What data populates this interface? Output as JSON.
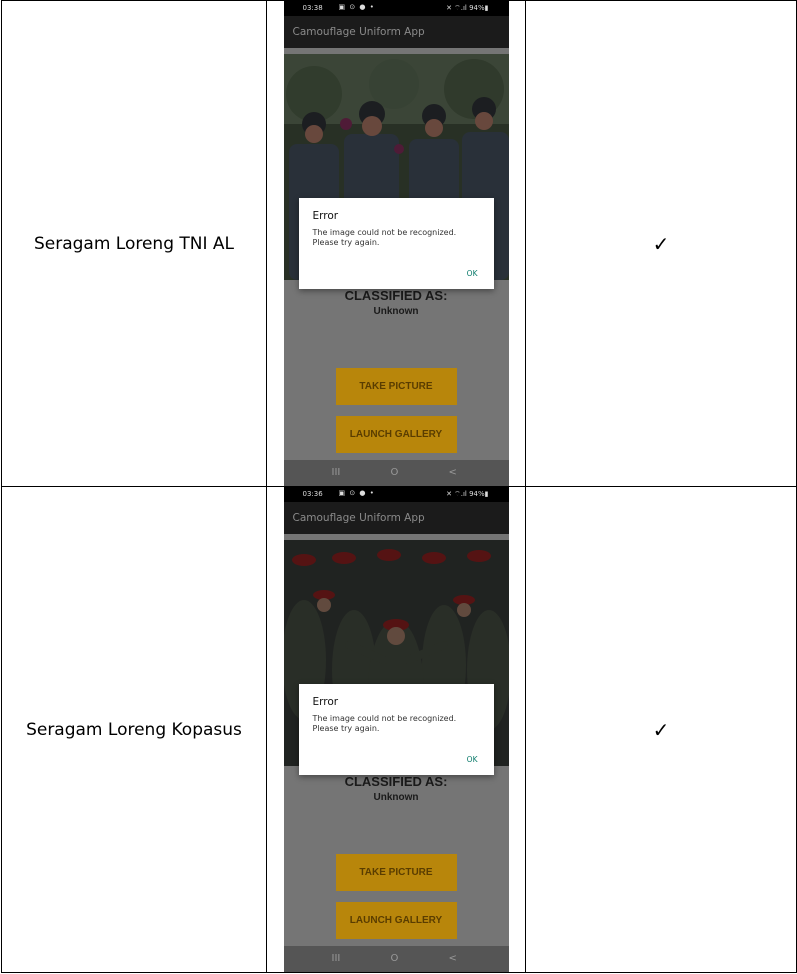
{
  "rows": [
    {
      "label": "Seragam Loreng TNI AL",
      "check": "✓",
      "phone": {
        "time": "03:38",
        "status_icons": "▣ ⊙ ● •",
        "status_right": "✕ ⌔.ıl 94%▮",
        "app_title": "Camouflage Uniform App",
        "classified_label": "CLASSIFIED AS:",
        "classified_value": "Unknown",
        "take_picture": "TAKE PICTURE",
        "launch_gallery": "LAUNCH GALLERY",
        "dialog": {
          "title": "Error",
          "message": "The image could not be recognized. Please try again.",
          "ok": "OK"
        },
        "nav_recent": "III",
        "nav_home": "O",
        "nav_back": "<"
      }
    },
    {
      "label": "Seragam Loreng Kopasus",
      "check": "✓",
      "phone": {
        "time": "03:36",
        "status_icons": "▣ ⊙ ● •",
        "status_right": "✕ ⌔.ıl 94%▮",
        "app_title": "Camouflage Uniform App",
        "classified_label": "CLASSIFIED AS:",
        "classified_value": "Unknown",
        "take_picture": "TAKE PICTURE",
        "launch_gallery": "LAUNCH GALLERY",
        "dialog": {
          "title": "Error",
          "message": "The image could not be recognized. Please try again.",
          "ok": "OK"
        },
        "nav_recent": "III",
        "nav_home": "O",
        "nav_back": "<"
      }
    }
  ],
  "colors": {
    "button_bg": "#b8860b",
    "overlay": "#757575",
    "dialog_ok": "#0a7a6a"
  }
}
